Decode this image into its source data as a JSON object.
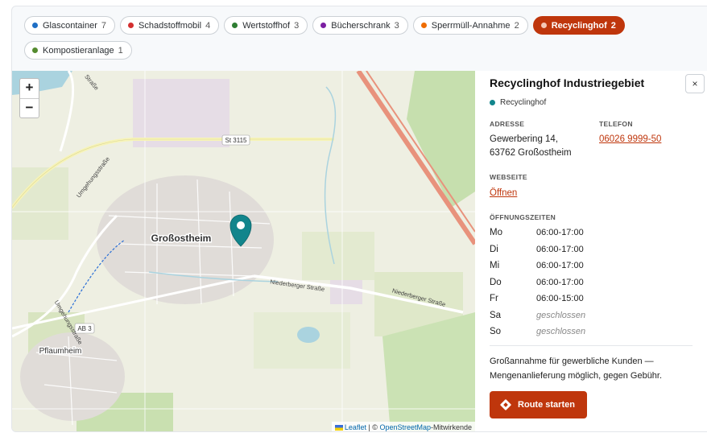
{
  "filters": [
    {
      "label": "Glascontainer",
      "count": "7",
      "color": "#1f6fc5"
    },
    {
      "label": "Schadstoffmobil",
      "count": "4",
      "color": "#d32f2f"
    },
    {
      "label": "Wertstoffhof",
      "count": "3",
      "color": "#2e7d32"
    },
    {
      "label": "Bücherschrank",
      "count": "3",
      "color": "#7b1fa2"
    },
    {
      "label": "Sperrmüll-Annahme",
      "count": "2",
      "color": "#ef6c00"
    },
    {
      "label": "Recyclinghof",
      "count": "2",
      "color": "#bf360c",
      "active": true
    },
    {
      "label": "Kompostieranlage",
      "count": "1",
      "color": "#558b2f"
    }
  ],
  "map": {
    "zoom_in": "+",
    "zoom_out": "−",
    "place_labels": {
      "town": "Großostheim",
      "town2": "Pflaumheim"
    },
    "road_labels": {
      "st3115": "St 3115",
      "ab3": "AB 3",
      "niederberger1": "Niederberger Straße",
      "niederberger2": "Niederberger Straße",
      "umgehung1": "Umgehungsstraße",
      "umgehung2": "Umgehungsstraße",
      "strasse": "Straße"
    },
    "attribution": {
      "leaflet": "Leaflet",
      "sep": " | © ",
      "osm": "OpenStreetMap",
      "suffix": "-Mitwirkende"
    }
  },
  "detail": {
    "title": "Recyclinghof Industriegebiet",
    "close": "×",
    "category": "Recyclinghof",
    "address_label": "ADRESSE",
    "address_line1": "Gewerbering 14,",
    "address_line2": "63762 Großostheim",
    "phone_label": "TELEFON",
    "phone": "06026 9999-50",
    "website_label": "WEBSEITE",
    "website_link": "Öffnen",
    "hours_label": "ÖFFNUNGSZEITEN",
    "hours": [
      {
        "day": "Mo",
        "time": "06:00-17:00",
        "closed": false
      },
      {
        "day": "Di",
        "time": "06:00-17:00",
        "closed": false
      },
      {
        "day": "Mi",
        "time": "06:00-17:00",
        "closed": false
      },
      {
        "day": "Do",
        "time": "06:00-17:00",
        "closed": false
      },
      {
        "day": "Fr",
        "time": "06:00-15:00",
        "closed": false
      },
      {
        "day": "Sa",
        "time": "geschlossen",
        "closed": true
      },
      {
        "day": "So",
        "time": "geschlossen",
        "closed": true
      }
    ],
    "note": "Großannahme für gewerbliche Kunden — Mengenanlieferung möglich, gegen Gebühr.",
    "route_button": "Route starten"
  },
  "colors": {
    "accent": "#bf360c",
    "marker": "#12858c"
  }
}
